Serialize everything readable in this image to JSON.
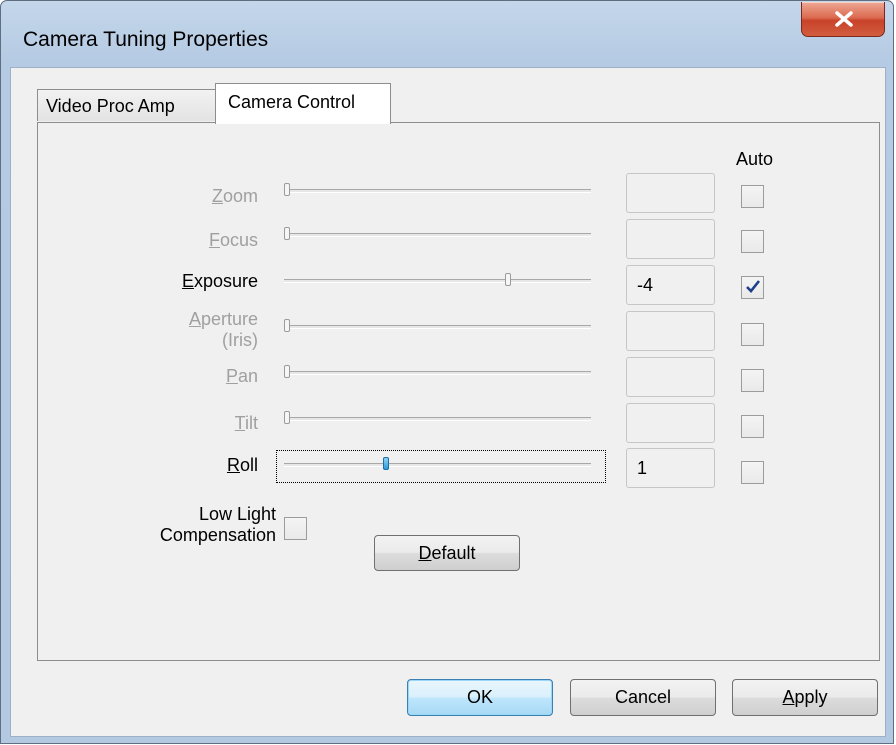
{
  "window": {
    "title": "Camera Tuning Properties"
  },
  "tabs": [
    {
      "label": "Video Proc Amp",
      "selected": false
    },
    {
      "label": "Camera Control",
      "selected": true
    }
  ],
  "columns": {
    "auto": "Auto"
  },
  "controls": [
    {
      "label": "Zoom",
      "enabled": false,
      "value": "",
      "auto": false,
      "level": 0
    },
    {
      "label": "Focus",
      "enabled": false,
      "value": "",
      "auto": false,
      "level": 0
    },
    {
      "label": "Exposure",
      "enabled": true,
      "value": "-4",
      "auto": true,
      "level": 0.74
    },
    {
      "label": "Aperture",
      "label2": "(Iris)",
      "enabled": false,
      "value": "",
      "auto": false,
      "level": 0
    },
    {
      "label": "Pan",
      "enabled": false,
      "value": "",
      "auto": false,
      "level": 0
    },
    {
      "label": "Tilt",
      "enabled": false,
      "value": "",
      "auto": false,
      "level": 0
    },
    {
      "label": "Roll",
      "enabled": true,
      "value": "1",
      "auto": false,
      "level": 0.33
    }
  ],
  "low_light": {
    "label_line1": "Low Light",
    "label_line2": "Compensation",
    "checked": false
  },
  "buttons": {
    "default": "Default",
    "ok": "OK",
    "cancel": "Cancel",
    "apply": "Apply"
  },
  "colors": {
    "accent": "#2e9cd8",
    "disabled_text": "#a0a0a0",
    "close_button": "#c8432a"
  }
}
